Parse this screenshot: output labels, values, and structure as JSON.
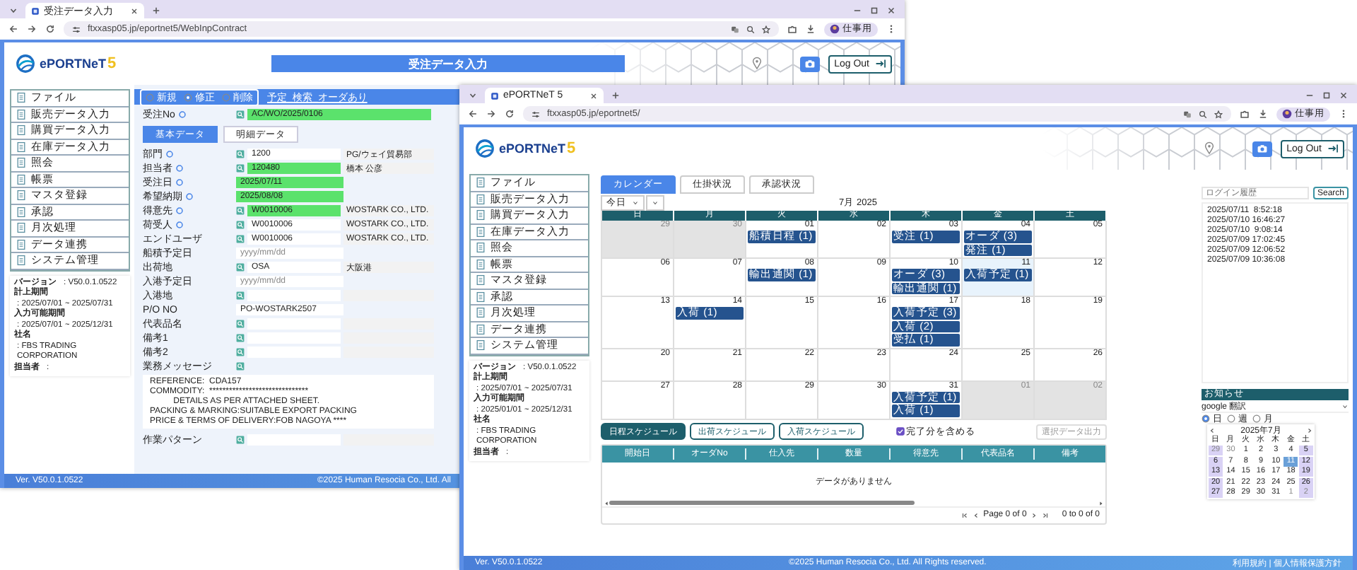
{
  "back_window": {
    "tab_title": "受注データ入力",
    "url": "ftxxasp05.jp/eportnet5/WebInpContract",
    "profile": "仕事用",
    "logo": {
      "text": "ePORTNeT",
      "mark": "5"
    },
    "page_title": "受注データ入力",
    "logout": "Log Out",
    "sidebar": [
      "ファイル",
      "販売データ入力",
      "購買データ入力",
      "在庫データ入力",
      "照会",
      "帳票",
      "マスタ登録",
      "承認",
      "月次処理",
      "データ連携",
      "システム管理"
    ],
    "info": [
      {
        "label": "バージョン",
        "value": ":  V50.0.1.0522"
      },
      {
        "label": "計上期間",
        "value": ":  2025/07/01 ~ 2025/07/31"
      },
      {
        "label": "入力可能期間",
        "value": ":  2025/07/01 ~ 2025/12/31"
      },
      {
        "label": "社名",
        "value": ":  FBS TRADING CORPORATION"
      },
      {
        "label": "担当者",
        "value": ":"
      }
    ],
    "modes": [
      {
        "label": "新規",
        "selected": false
      },
      {
        "label": "修正",
        "selected": true
      },
      {
        "label": "削除",
        "selected": false
      }
    ],
    "mode_link": "予定_検索_オーダあり",
    "order_no": {
      "label": "受注No",
      "required": true,
      "value": "AC/WO/2025/0106"
    },
    "tabs": [
      {
        "label": "基本データ",
        "selected": true
      },
      {
        "label": "明細データ",
        "selected": false
      }
    ],
    "fields": [
      {
        "kind": "code",
        "label": "部門",
        "required": true,
        "highlight": false,
        "value": "1200",
        "side": "PG/ウェイ貿易部"
      },
      {
        "kind": "code",
        "label": "担当者",
        "required": true,
        "highlight": true,
        "value": "120480",
        "side": "橋本 公彦"
      },
      {
        "kind": "date",
        "label": "受注日",
        "required": true,
        "highlight": true,
        "value": "2025/07/11"
      },
      {
        "kind": "date",
        "label": "希望納期",
        "required": true,
        "highlight": true,
        "value": "2025/08/08"
      },
      {
        "kind": "code",
        "label": "得意先",
        "required": true,
        "highlight": true,
        "value": "W0010006",
        "side": "WOSTARK CO., LTD."
      },
      {
        "kind": "code",
        "label": "荷受人",
        "required": true,
        "highlight": false,
        "value": "W0010006",
        "side": "WOSTARK CO., LTD."
      },
      {
        "kind": "code",
        "label": "エンドユーザ",
        "required": false,
        "highlight": false,
        "value": "W0010006",
        "side": "WOSTARK CO., LTD."
      },
      {
        "kind": "date",
        "label": "船積予定日",
        "required": false,
        "highlight": false,
        "placeholder": "yyyy/mm/dd"
      },
      {
        "kind": "code",
        "label": "出荷地",
        "required": false,
        "highlight": false,
        "value": "OSA",
        "side": "大阪港"
      },
      {
        "kind": "date",
        "label": "入港予定日",
        "required": false,
        "highlight": false,
        "placeholder": "yyyy/mm/dd"
      },
      {
        "kind": "code",
        "label": "入港地",
        "required": false,
        "highlight": false
      },
      {
        "kind": "text",
        "label": "P/O NO",
        "required": false,
        "highlight": false,
        "value": "PO-WOSTARK2507"
      },
      {
        "kind": "code",
        "label": "代表品名",
        "required": false,
        "highlight": false
      },
      {
        "kind": "code",
        "label": "備考1",
        "required": false,
        "highlight": false
      },
      {
        "kind": "code",
        "label": "備考2",
        "required": false,
        "highlight": false
      },
      {
        "kind": "message",
        "label": "業務メッセージ",
        "required": false,
        "highlight": false,
        "value": "REFERENCE:  CDA157\nCOMMODITY:  ******************************\n          DETAILS AS PER ATTACHED SHEET.\nPACKING & MARKING:SUITABLE EXPORT PACKING\nPRICE & TERMS OF DELIVERY:FOB NAGOYA ****"
      },
      {
        "kind": "code",
        "label": "作業パターン",
        "required": false,
        "highlight": false
      }
    ],
    "footer": {
      "version": "Ver. V50.0.1.0522",
      "copyright": "©2025 Human Resocia Co., Ltd. All"
    }
  },
  "front_window": {
    "tab_title": "ePORTNeT 5",
    "url": "ftxxasp05.jp/eportnet5/",
    "profile": "仕事用",
    "logo": {
      "text": "ePORTNeT",
      "mark": "5"
    },
    "logout": "Log Out",
    "sidebar": [
      "ファイル",
      "販売データ入力",
      "購買データ入力",
      "在庫データ入力",
      "照会",
      "帳票",
      "マスタ登録",
      "承認",
      "月次処理",
      "データ連携",
      "システム管理"
    ],
    "info": [
      {
        "label": "バージョン",
        "value": ":  V50.0.1.0522"
      },
      {
        "label": "計上期間",
        "value": ":  2025/07/01 ~ 2025/07/31"
      },
      {
        "label": "入力可能期間",
        "value": ":  2025/01/01 ~ 2025/12/31"
      },
      {
        "label": "社名",
        "value": ":  FBS TRADING CORPORATION"
      },
      {
        "label": "担当者",
        "value": ":"
      }
    ],
    "tabs": [
      {
        "label": "カレンダー",
        "selected": true
      },
      {
        "label": "仕掛状況",
        "selected": false
      },
      {
        "label": "承認状況",
        "selected": false
      }
    ],
    "calendar": {
      "today_button": "今日",
      "title": "7月 2025",
      "weekdays": [
        "日",
        "月",
        "火",
        "水",
        "木",
        "金",
        "土"
      ],
      "weeks": [
        [
          {
            "day": "29",
            "other": true,
            "today": false
          },
          {
            "day": "30",
            "other": true,
            "today": false
          },
          {
            "day": "01",
            "other": false,
            "today": false,
            "events": [
              "船積日程 (1)"
            ]
          },
          {
            "day": "02",
            "other": false,
            "today": false
          },
          {
            "day": "03",
            "other": false,
            "today": false,
            "events": [
              "受注 (1)"
            ]
          },
          {
            "day": "04",
            "other": false,
            "today": false,
            "events": [
              "オーダ (3)",
              "発注 (1)"
            ]
          },
          {
            "day": "05",
            "other": false,
            "today": false
          }
        ],
        [
          {
            "day": "06",
            "other": false,
            "today": false
          },
          {
            "day": "07",
            "other": false,
            "today": false
          },
          {
            "day": "08",
            "other": false,
            "today": false,
            "events": [
              "輸出通関 (1)"
            ]
          },
          {
            "day": "09",
            "other": false,
            "today": false
          },
          {
            "day": "10",
            "other": false,
            "today": false,
            "events": [
              "オーダ (3)",
              "輸出通関 (1)"
            ]
          },
          {
            "day": "11",
            "other": false,
            "today": true,
            "events": [
              "入荷予定 (1)"
            ]
          },
          {
            "day": "12",
            "other": false,
            "today": false
          }
        ],
        [
          {
            "day": "13",
            "other": false,
            "today": false
          },
          {
            "day": "14",
            "other": false,
            "today": false,
            "events": [
              "入荷 (1)"
            ]
          },
          {
            "day": "15",
            "other": false,
            "today": false
          },
          {
            "day": "16",
            "other": false,
            "today": false
          },
          {
            "day": "17",
            "other": false,
            "today": false,
            "events": [
              "入荷予定 (3)",
              "入荷 (2)",
              "受払 (1)"
            ]
          },
          {
            "day": "18",
            "other": false,
            "today": false
          },
          {
            "day": "19",
            "other": false,
            "today": false
          }
        ],
        [
          {
            "day": "20",
            "other": false,
            "today": false
          },
          {
            "day": "21",
            "other": false,
            "today": false
          },
          {
            "day": "22",
            "other": false,
            "today": false
          },
          {
            "day": "23",
            "other": false,
            "today": false
          },
          {
            "day": "24",
            "other": false,
            "today": false
          },
          {
            "day": "25",
            "other": false,
            "today": false
          },
          {
            "day": "26",
            "other": false,
            "today": false
          }
        ],
        [
          {
            "day": "27",
            "other": false,
            "today": false
          },
          {
            "day": "28",
            "other": false,
            "today": false
          },
          {
            "day": "29",
            "other": false,
            "today": false
          },
          {
            "day": "30",
            "other": false,
            "today": false
          },
          {
            "day": "31",
            "other": false,
            "today": false,
            "events": [
              "入荷予定 (1)",
              "入荷 (1)"
            ]
          },
          {
            "day": "01",
            "other": true,
            "today": false
          },
          {
            "day": "02",
            "other": true,
            "today": false
          }
        ]
      ]
    },
    "schedule_buttons": [
      {
        "label": "日程スケジュール",
        "selected": true
      },
      {
        "label": "出荷スケジュール",
        "selected": false
      },
      {
        "label": "入荷スケジュール",
        "selected": false
      }
    ],
    "include_done": {
      "label": "完了分を含める",
      "checked": true
    },
    "export_button": {
      "label": "選択データ出力",
      "disabled": true
    },
    "table": {
      "columns": [
        "開始日",
        "オーダNo",
        "仕入先",
        "数量",
        "得意先",
        "代表品名",
        "備考"
      ],
      "empty": "データがありません"
    },
    "pagination": {
      "page": "Page 0 of 0",
      "range": "0 to 0 of 0"
    },
    "side_panel": {
      "search_placeholder": "ログイン履歴",
      "search_button": "Search",
      "history": [
        "2025/07/11  8:52:18",
        "2025/07/10 16:46:27",
        "2025/07/10  9:08:14",
        "2025/07/09 17:02:45",
        "2025/07/09 12:06:52",
        "2025/07/09 10:36:08"
      ],
      "notice_title": "お知らせ",
      "notice_select": "google 翻訳",
      "views": [
        {
          "label": "日",
          "selected": true
        },
        {
          "label": "週",
          "selected": false
        },
        {
          "label": "月",
          "selected": false
        }
      ],
      "mini_calendar": {
        "title": "2025年7月",
        "weekdays": [
          "日",
          "月",
          "火",
          "水",
          "木",
          "金",
          "土"
        ],
        "weeks": [
          [
            {
              "day": "29",
              "other": true,
              "selected": false
            },
            {
              "day": "30",
              "other": true,
              "selected": false
            },
            {
              "day": "1",
              "other": false,
              "selected": false
            },
            {
              "day": "2",
              "other": false,
              "selected": false
            },
            {
              "day": "3",
              "other": false,
              "selected": false
            },
            {
              "day": "4",
              "other": false,
              "selected": false
            },
            {
              "day": "5",
              "other": false,
              "selected": false
            }
          ],
          [
            {
              "day": "6",
              "other": false,
              "selected": false
            },
            {
              "day": "7",
              "other": false,
              "selected": false
            },
            {
              "day": "8",
              "other": false,
              "selected": false
            },
            {
              "day": "9",
              "other": false,
              "selected": false
            },
            {
              "day": "10",
              "other": false,
              "selected": false
            },
            {
              "day": "11",
              "other": false,
              "selected": true
            },
            {
              "day": "12",
              "other": false,
              "selected": false
            }
          ],
          [
            {
              "day": "13",
              "other": false,
              "selected": false
            },
            {
              "day": "14",
              "other": false,
              "selected": false
            },
            {
              "day": "15",
              "other": false,
              "selected": false
            },
            {
              "day": "16",
              "other": false,
              "selected": false
            },
            {
              "day": "17",
              "other": false,
              "selected": false
            },
            {
              "day": "18",
              "other": false,
              "selected": false
            },
            {
              "day": "19",
              "other": false,
              "selected": false
            }
          ],
          [
            {
              "day": "20",
              "other": false,
              "selected": false
            },
            {
              "day": "21",
              "other": false,
              "selected": false
            },
            {
              "day": "22",
              "other": false,
              "selected": false
            },
            {
              "day": "23",
              "other": false,
              "selected": false
            },
            {
              "day": "24",
              "other": false,
              "selected": false
            },
            {
              "day": "25",
              "other": false,
              "selected": false
            },
            {
              "day": "26",
              "other": false,
              "selected": false
            }
          ],
          [
            {
              "day": "27",
              "other": false,
              "selected": false
            },
            {
              "day": "28",
              "other": false,
              "selected": false
            },
            {
              "day": "29",
              "other": false,
              "selected": false
            },
            {
              "day": "30",
              "other": false,
              "selected": false
            },
            {
              "day": "31",
              "other": false,
              "selected": false
            },
            {
              "day": "1",
              "other": true,
              "selected": false
            },
            {
              "day": "2",
              "other": true,
              "selected": false
            }
          ]
        ]
      }
    },
    "footer": {
      "version": "Ver. V50.0.1.0522",
      "copyright": "©2025 Human Resocia Co., Ltd. All Rights reserved.",
      "links": "利用規約 | 個人情報保護方針"
    }
  }
}
